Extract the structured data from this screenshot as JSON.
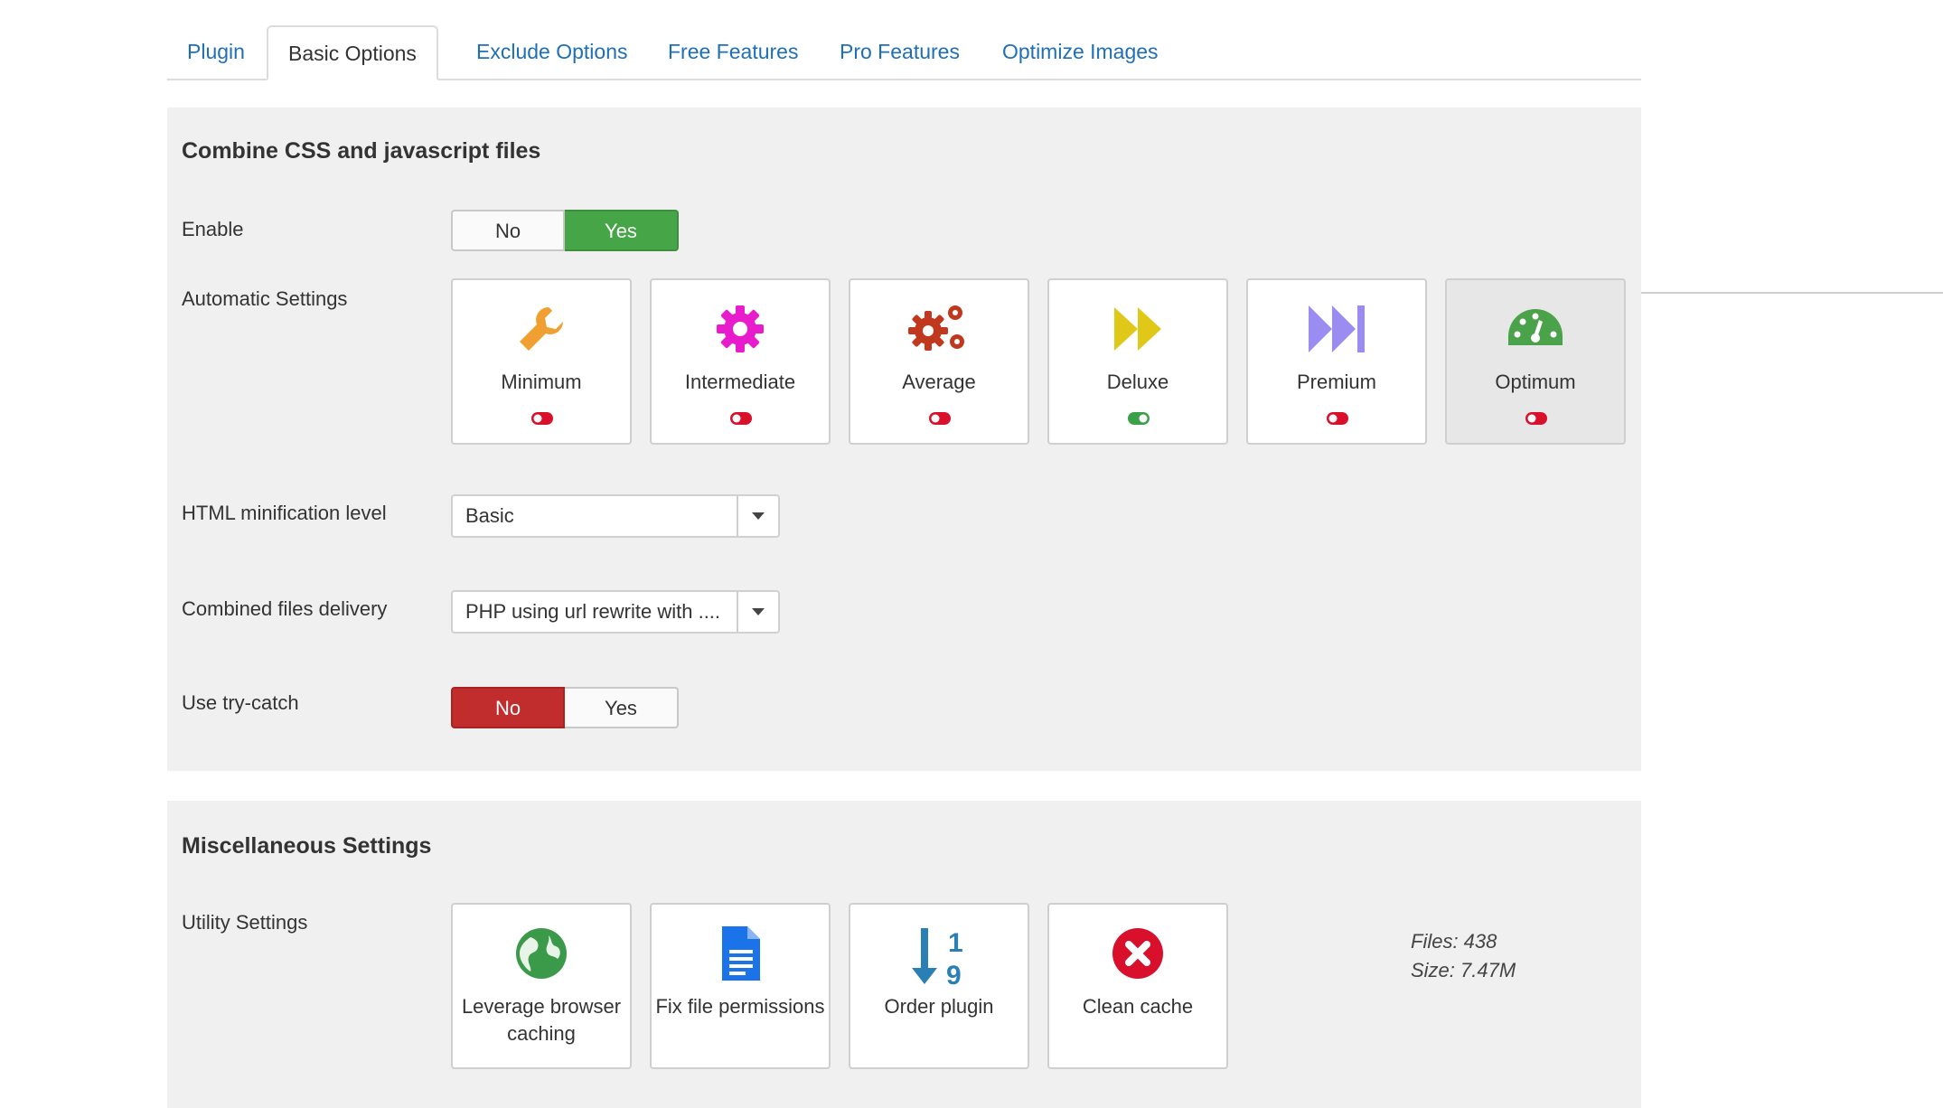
{
  "tabs": [
    "Plugin",
    "Basic Options",
    "Exclude Options",
    "Free Features",
    "Pro Features",
    "Optimize Images"
  ],
  "active_tab": "Basic Options",
  "combine": {
    "title": "Combine CSS and javascript files",
    "enable": {
      "label": "Enable",
      "no": "No",
      "yes": "Yes",
      "value": "Yes"
    },
    "auto": {
      "label": "Automatic Settings",
      "presets": [
        {
          "name": "Minimum",
          "icon": "wrench-icon",
          "color": "#f0a030",
          "enabled": false
        },
        {
          "name": "Intermediate",
          "icon": "gear-icon",
          "color": "#e81ccc",
          "enabled": false
        },
        {
          "name": "Average",
          "icon": "gears-icon",
          "color": "#c0391e",
          "enabled": false
        },
        {
          "name": "Deluxe",
          "icon": "fast-forward-icon",
          "color": "#e0c818",
          "enabled": true
        },
        {
          "name": "Premium",
          "icon": "skip-forward-icon",
          "color": "#9a8cf0",
          "enabled": false
        },
        {
          "name": "Optimum",
          "icon": "dashboard-icon",
          "color": "#4aa24a",
          "enabled": false,
          "selected": true
        }
      ]
    },
    "html_min": {
      "label": "HTML minification level",
      "value": "Basic"
    },
    "delivery": {
      "label": "Combined files delivery",
      "value": "PHP using url rewrite with ...."
    },
    "trycatch": {
      "label": "Use try-catch",
      "no": "No",
      "yes": "Yes",
      "value": "No"
    }
  },
  "misc": {
    "title": "Miscellaneous Settings",
    "utility_label": "Utility Settings",
    "buttons": [
      {
        "name": "Leverage browser caching",
        "icon": "globe-icon"
      },
      {
        "name": "Fix file permissions",
        "icon": "file-icon"
      },
      {
        "name": "Order plugin",
        "icon": "sort-numeric-icon"
      },
      {
        "name": "Clean cache",
        "icon": "close-circle-icon"
      }
    ],
    "files": "Files: 438",
    "size": "Size: 7.47M"
  },
  "colors": {
    "accent": "#1e6fb5",
    "green": "#46a546",
    "red": "#c12c2c",
    "panel": "#f0f0f0"
  }
}
